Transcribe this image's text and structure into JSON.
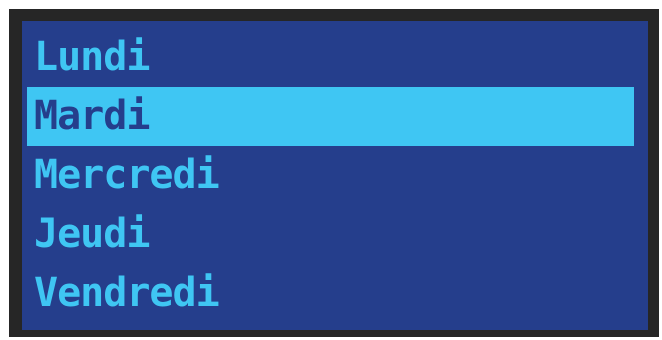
{
  "list": {
    "items": [
      {
        "label": "Lundi",
        "selected": false
      },
      {
        "label": "Mardi",
        "selected": true
      },
      {
        "label": "Mercredi",
        "selected": false
      },
      {
        "label": "Jeudi",
        "selected": false
      },
      {
        "label": "Vendredi",
        "selected": false
      }
    ]
  },
  "colors": {
    "frame": "#262626",
    "background": "#253e8c",
    "text": "#3fc6f3",
    "highlight": "#3fc6f3",
    "highlight_text": "#253e8c"
  }
}
